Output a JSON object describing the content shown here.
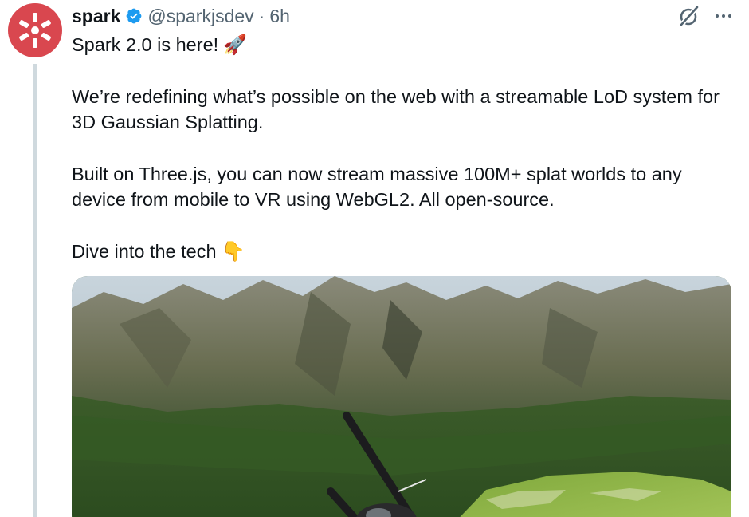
{
  "author": {
    "display_name": "spark",
    "handle": "@sparkjsdev",
    "separator": "·",
    "time": "6h"
  },
  "tweet": {
    "line1": "Spark 2.0 is here!",
    "line1_emoji": "🚀",
    "paragraph2": "We’re redefining what’s possible on the web with a streamable LoD system for 3D Gaussian Splatting.",
    "paragraph3": "Built on Three.js, you can now stream massive 100M+ splat worlds to any device from mobile to VR using WebGL2. All open-source.",
    "paragraph4": "Dive into the tech",
    "paragraph4_emoji": "👇"
  },
  "icons": {
    "avatar": "spark-logo-icon",
    "verified": "verified-badge-icon",
    "grok": "grok-icon",
    "more": "more-icon"
  },
  "colors": {
    "avatar_bg": "#d9474f",
    "verified": "#1d9bf0",
    "secondary_text": "#536471"
  }
}
